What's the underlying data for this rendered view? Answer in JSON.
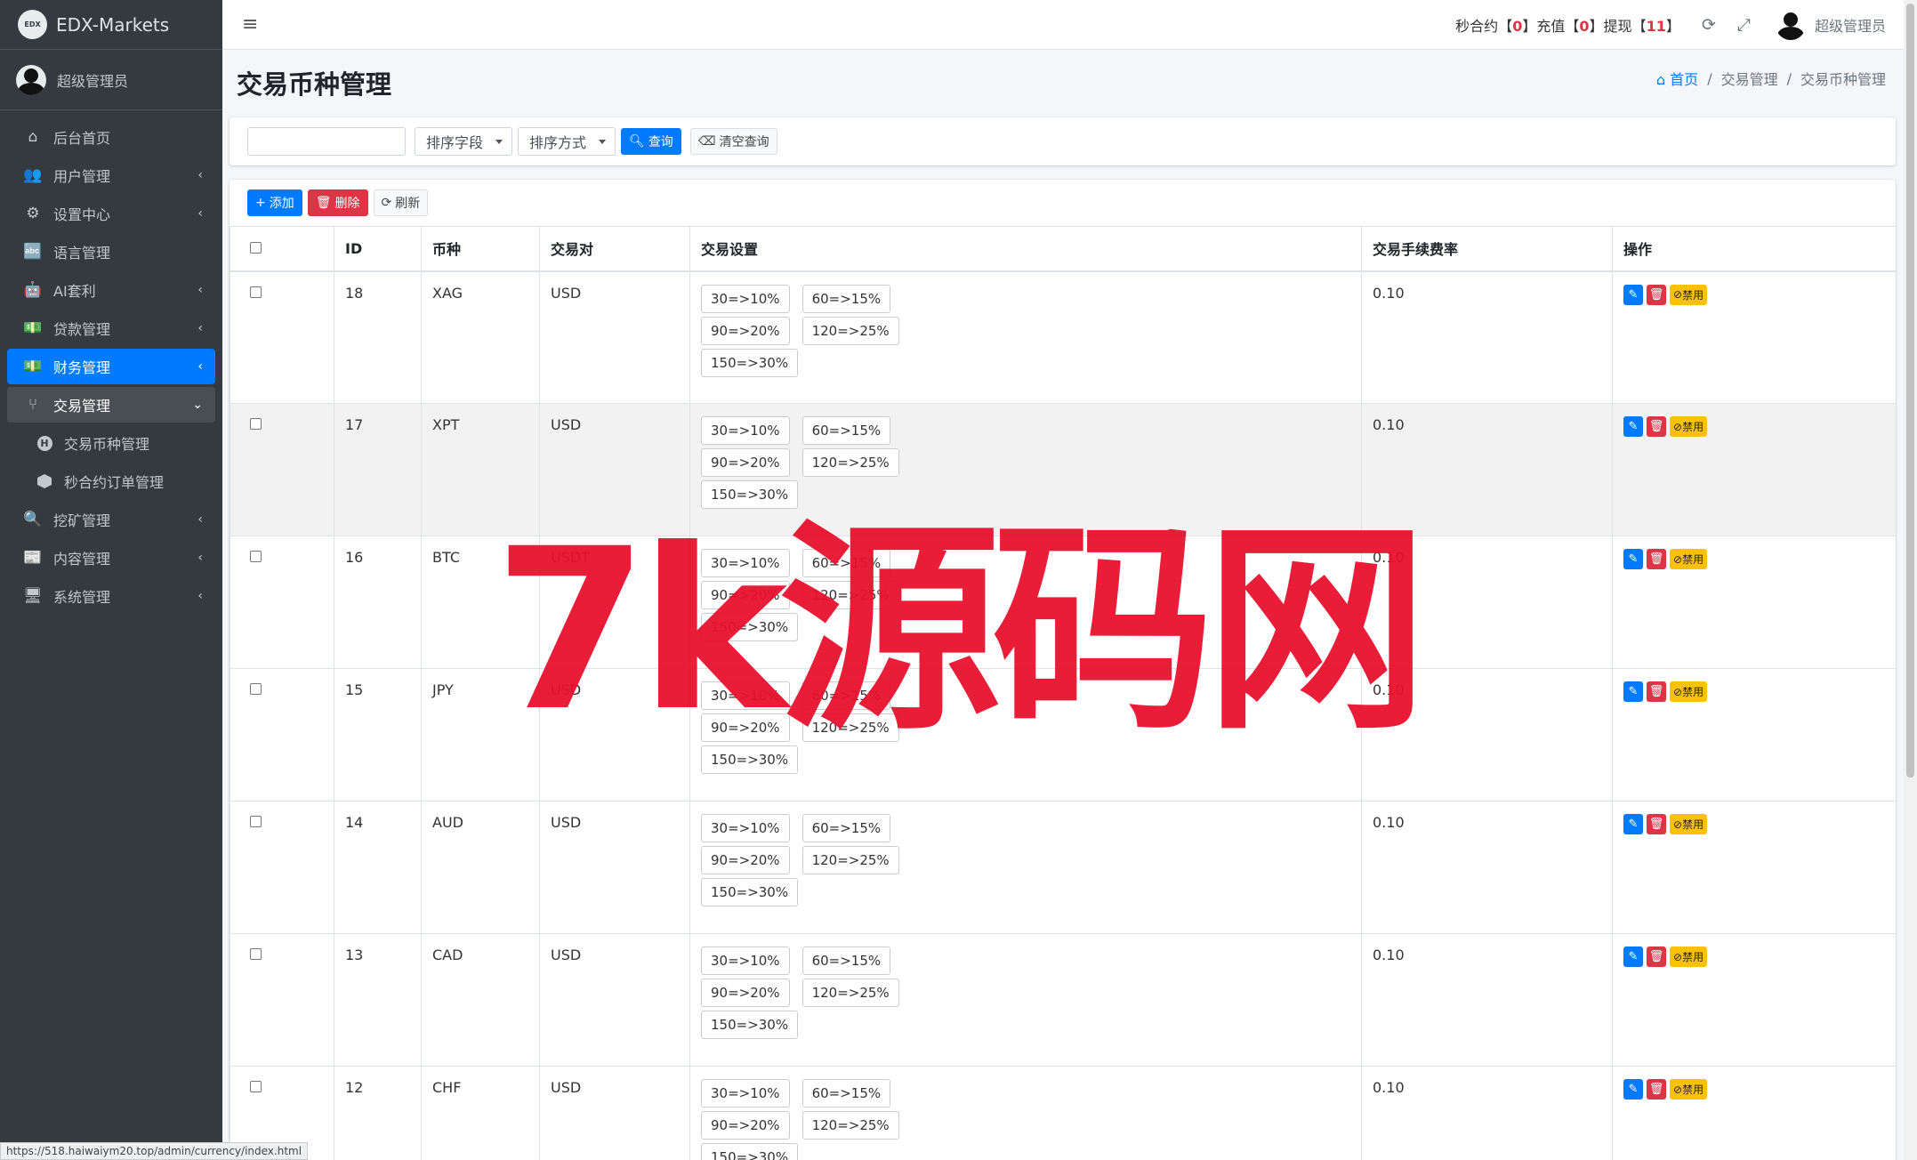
{
  "brand": {
    "name": "EDX-Markets",
    "logo_text": "EDX"
  },
  "sidebar": {
    "user": "超级管理员",
    "items": [
      {
        "label": "后台首页",
        "icon": "⌂",
        "chev": ""
      },
      {
        "label": "用户管理",
        "icon": "👥",
        "chev": "‹"
      },
      {
        "label": "设置中心",
        "icon": "⚙",
        "chev": "‹"
      },
      {
        "label": "语言管理",
        "icon": "🔤",
        "chev": ""
      },
      {
        "label": "AI套利",
        "icon": "🤖",
        "chev": "‹"
      },
      {
        "label": "贷款管理",
        "icon": "💵",
        "chev": "‹"
      },
      {
        "label": "财务管理",
        "icon": "💵",
        "chev": "‹"
      },
      {
        "label": "交易管理",
        "icon": "⑂",
        "chev": "⌄"
      }
    ],
    "sub_items": [
      {
        "label": "交易币种管理"
      },
      {
        "label": "秒合约订单管理"
      }
    ],
    "items_after": [
      {
        "label": "挖矿管理",
        "icon": "🔍",
        "chev": "‹"
      },
      {
        "label": "内容管理",
        "icon": "📰",
        "chev": "‹"
      },
      {
        "label": "系统管理",
        "icon": "🖥",
        "chev": "‹"
      }
    ]
  },
  "topbar": {
    "menu_icon": "≡",
    "stats": [
      {
        "label": "秒合约",
        "value": "0"
      },
      {
        "label": "充值",
        "value": "0"
      },
      {
        "label": "提现",
        "value": "11"
      }
    ],
    "refresh_icon": "⟳",
    "fullscreen_icon": "⤢",
    "user": "超级管理员"
  },
  "page": {
    "title": "交易币种管理",
    "breadcrumb": [
      "首页",
      "交易管理",
      "交易币种管理"
    ]
  },
  "filter": {
    "search_value": "",
    "sort_field": "排序字段",
    "sort_order": "排序方式",
    "query_btn": "查询",
    "clear_btn": "清空查询"
  },
  "toolbar": {
    "add": "添加",
    "delete": "删除",
    "refresh": "刷新"
  },
  "table": {
    "headers": [
      "",
      "ID",
      "币种",
      "交易对",
      "交易设置",
      "交易手续费率",
      "操作"
    ],
    "rows": [
      {
        "id": "18",
        "coin": "XAG",
        "pair": "USD",
        "fee": "0.10"
      },
      {
        "id": "17",
        "coin": "XPT",
        "pair": "USD",
        "fee": "0.10"
      },
      {
        "id": "16",
        "coin": "BTC",
        "pair": "USDT",
        "fee": "0.10"
      },
      {
        "id": "15",
        "coin": "JPY",
        "pair": "USD",
        "fee": "0.10"
      },
      {
        "id": "14",
        "coin": "AUD",
        "pair": "USD",
        "fee": "0.10"
      },
      {
        "id": "13",
        "coin": "CAD",
        "pair": "USD",
        "fee": "0.10"
      },
      {
        "id": "12",
        "coin": "CHF",
        "pair": "USD",
        "fee": "0.10"
      }
    ],
    "settings": [
      "30=>10%",
      "60=>15%",
      "90=>20%",
      "120=>25%",
      "150=>30%"
    ],
    "ban_label": "禁用"
  },
  "statusbar": {
    "url": "https://518.haiwaiym20.top/admin/currency/index.html"
  },
  "watermark": "7k源码网"
}
